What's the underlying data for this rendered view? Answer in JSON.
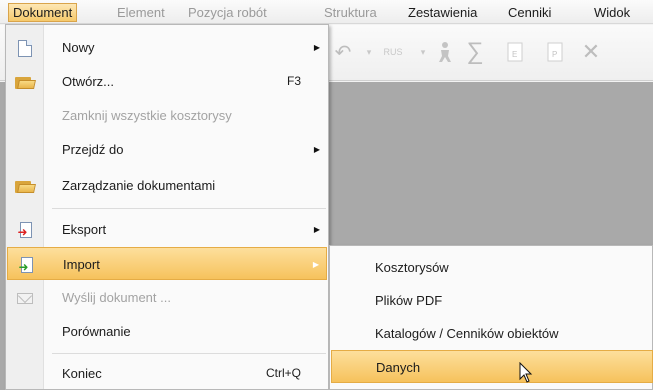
{
  "menubar": {
    "items": [
      {
        "label": "Dokument",
        "state": "active"
      },
      {
        "label": "Element",
        "state": "disabled"
      },
      {
        "label": "Pozycja robót",
        "state": "disabled"
      },
      {
        "label": "Struktura",
        "state": "disabled"
      },
      {
        "label": "Zestawienia",
        "state": "normal"
      },
      {
        "label": "Cenniki",
        "state": "normal"
      },
      {
        "label": "Widok",
        "state": "normal"
      }
    ]
  },
  "toolbar": {
    "icons": [
      "undo-icon",
      "rus-icon",
      "person-icon",
      "sum-icon",
      "export-e-icon",
      "export-p-icon",
      "delete-icon"
    ],
    "rus_label": "RUS",
    "e_label": "E",
    "p_label": "P"
  },
  "dropdown": {
    "items": [
      {
        "label": "Nowy",
        "icon": "new-document-icon",
        "shortcut": "",
        "submenu": true,
        "state": "normal"
      },
      {
        "label": "Otwórz...",
        "icon": "open-folder-icon",
        "shortcut": "F3",
        "submenu": false,
        "state": "normal"
      },
      {
        "label": "Zamknij wszystkie kosztorysy",
        "icon": "",
        "shortcut": "",
        "submenu": false,
        "state": "disabled"
      },
      {
        "label": "Przejdź do",
        "icon": "",
        "shortcut": "",
        "submenu": true,
        "state": "normal"
      },
      {
        "label": "Zarządzanie dokumentami",
        "icon": "folder-icon",
        "shortcut": "",
        "submenu": false,
        "state": "normal"
      },
      {
        "label": "Eksport",
        "icon": "export-icon",
        "shortcut": "",
        "submenu": true,
        "state": "normal"
      },
      {
        "label": "Import",
        "icon": "import-icon",
        "shortcut": "",
        "submenu": true,
        "state": "highlighted"
      },
      {
        "label": "Wyślij dokument ...",
        "icon": "mail-icon",
        "shortcut": "",
        "submenu": false,
        "state": "disabled"
      },
      {
        "label": "Porównanie",
        "icon": "",
        "shortcut": "",
        "submenu": false,
        "state": "normal"
      },
      {
        "label": "Koniec",
        "icon": "",
        "shortcut": "Ctrl+Q",
        "submenu": false,
        "state": "normal"
      }
    ]
  },
  "submenu": {
    "items": [
      {
        "label": "Kosztorysów",
        "state": "normal"
      },
      {
        "label": "Plików PDF",
        "state": "normal"
      },
      {
        "label": "Katalogów / Cenników obiektów",
        "state": "normal"
      },
      {
        "label": "Danych",
        "state": "highlighted"
      }
    ]
  },
  "colors": {
    "highlight": "#f6c25c",
    "highlight_border": "#e5ac45",
    "workspace": "#a9a9a9",
    "disabled_text": "#a3a3a3"
  }
}
